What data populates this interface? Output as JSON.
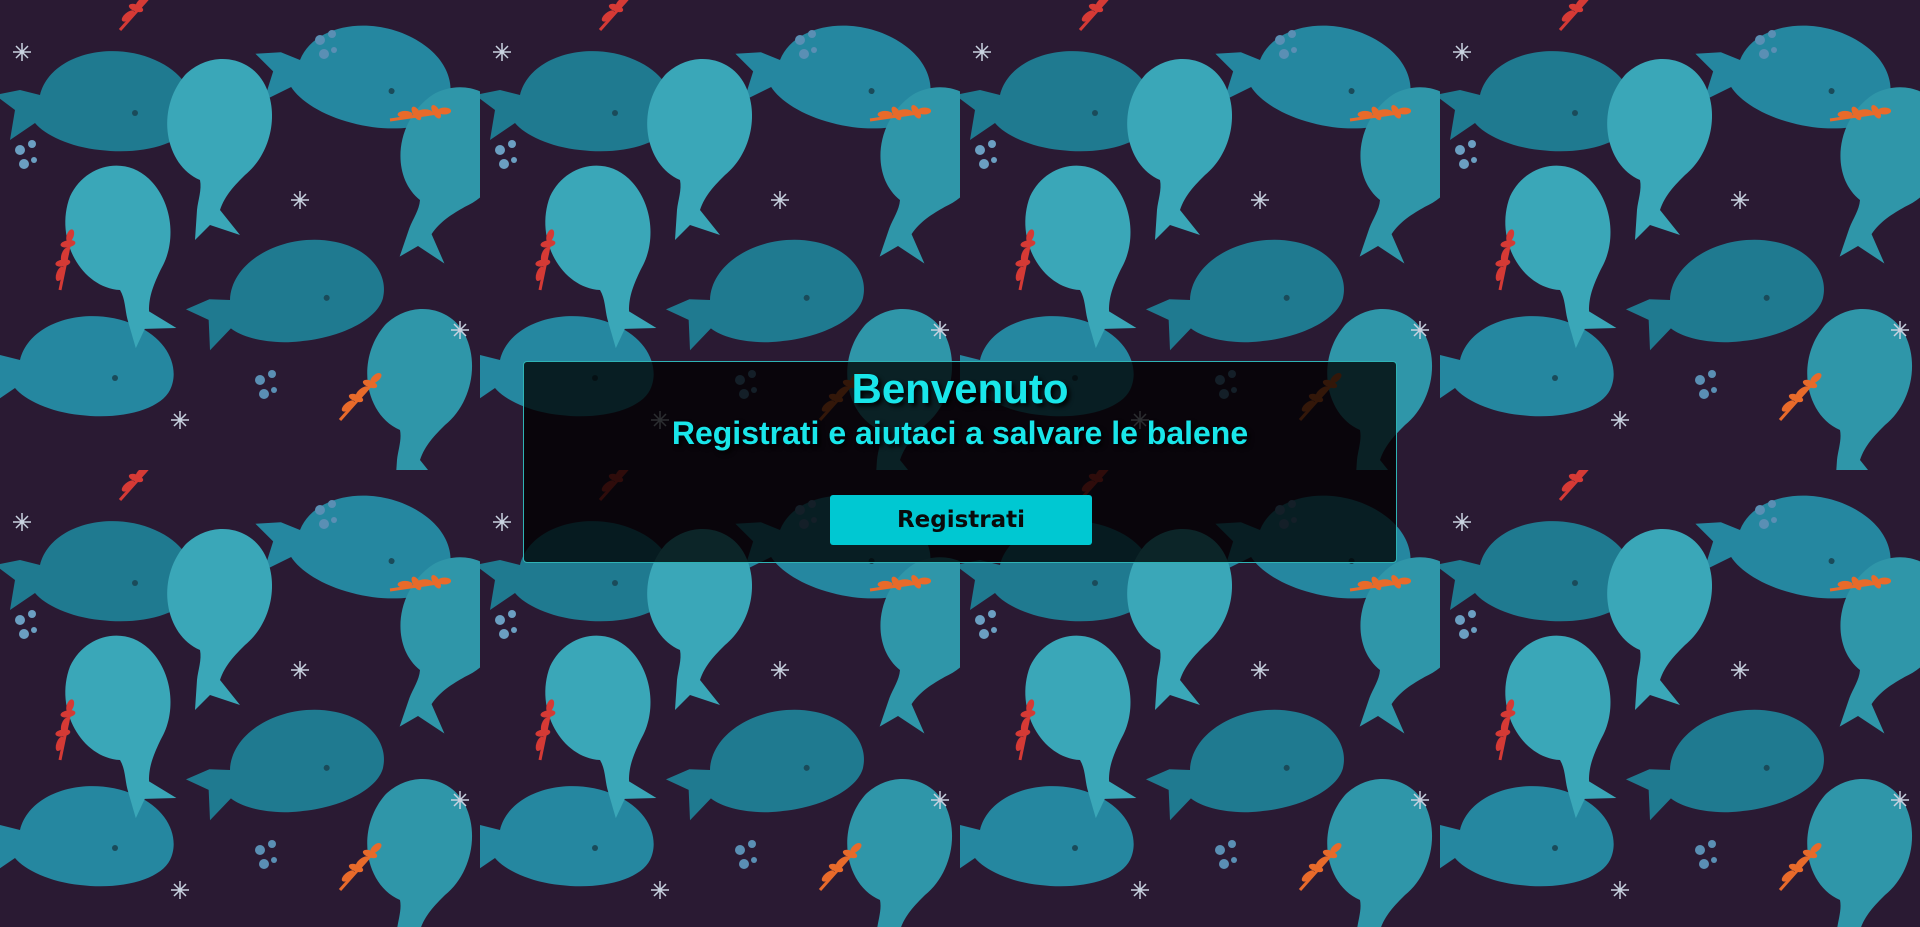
{
  "colors": {
    "background": "#2a1a33",
    "whale_dark": "#1f7a90",
    "whale_light": "#3aa7b8",
    "accent": "#19e6ea",
    "button": "#00c8d2",
    "seaweed_red": "#d63a35",
    "seaweed_orange": "#e86a2a"
  },
  "background": {
    "pattern": "whales",
    "decor": [
      "whale-icon",
      "seaweed-icon",
      "star-icon",
      "bubble-icon"
    ]
  },
  "hero": {
    "title": "Benvenuto",
    "subtitle": "Registrati e aiutaci a salvare le balene",
    "register_label": "Registrati"
  }
}
